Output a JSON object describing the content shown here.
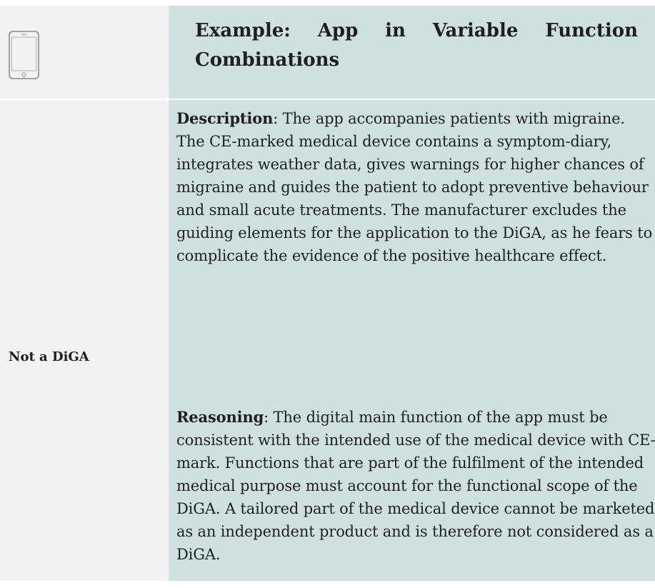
{
  "header": {
    "icon": "tablet-icon",
    "title": "Example: App in Variable Function Combinations"
  },
  "row": {
    "verdict": "Not a DiGA",
    "description": {
      "label": "Description",
      "text": ": The app accompanies patients with migraine. The CE-marked medical device contains a symptom-diary, integrates weather data, gives warnings for higher chances of migraine and guides the patient to adopt preventive behaviour and small acute treatments. The manufacturer excludes the guiding elements for the application to the DiGA, as he fears to complicate the evidence of the positive healthcare effect."
    },
    "reasoning": {
      "label": "Reasoning",
      "text": ": The digital main function of the app must be consistent with the intended use of the medical device with CE-mark. Functions that are part of the fulfilment of the intended medical purpose must account for the functional scope of the DiGA. A tailored part of the medical device cannot be marketed as an independent product and is therefore not considered as a DiGA."
    }
  },
  "colors": {
    "left_column": "#f2f2f2",
    "right_column": "#cfe1de",
    "text": "#1f1f1f"
  }
}
